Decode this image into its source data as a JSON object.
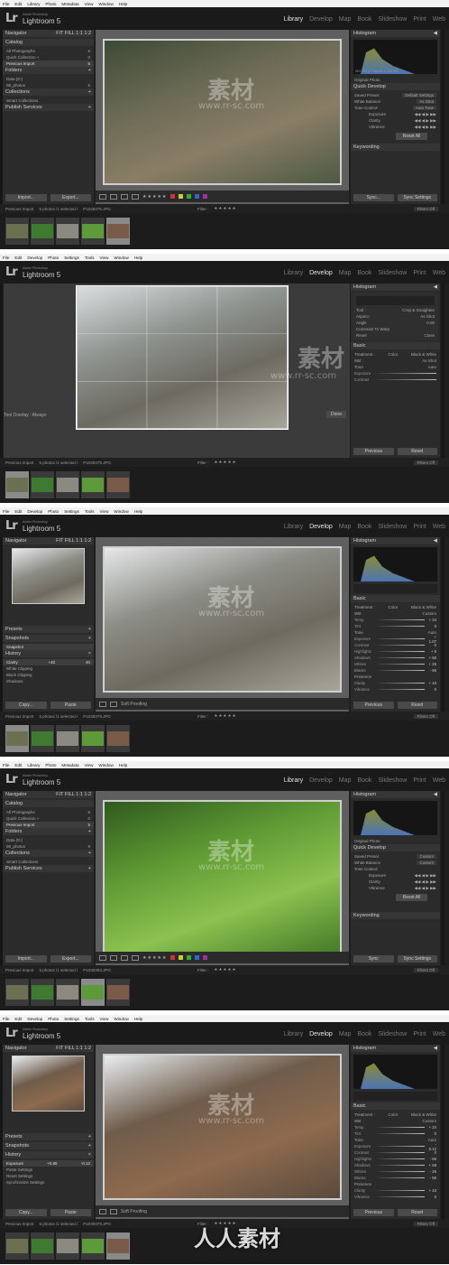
{
  "menus": {
    "library": [
      "File",
      "Edit",
      "Library",
      "Photo",
      "Metadata",
      "View",
      "Window",
      "Help"
    ],
    "develop": [
      "File",
      "Edit",
      "Develop",
      "Photo",
      "Settings",
      "Tools",
      "View",
      "Window",
      "Help"
    ]
  },
  "app": {
    "brand_small": "Adobe Photoshop",
    "brand": "Lightroom 5",
    "logo": "Lr"
  },
  "modules": [
    "Library",
    "Develop",
    "Map",
    "Book",
    "Slideshow",
    "Print",
    "Web"
  ],
  "frames": [
    {
      "active_module": "Library",
      "left": {
        "sections": [
          {
            "title": "Navigator",
            "extra": "FIT  FILL  1:1  1:2 ",
            "rows": []
          },
          {
            "title": "Catalog",
            "extra": "",
            "rows": [
              {
                "l": "All Photographs",
                "r": "5"
              },
              {
                "l": "Quick Collection +",
                "r": "0"
              },
              {
                "l": "Previous Import",
                "r": "5",
                "hl": true
              }
            ]
          },
          {
            "title": "Folders",
            "extra": "+",
            "rows": [
              {
                "l": "Data (D:)",
                "r": ""
              },
              {
                "l": "08_photos",
                "r": "5"
              }
            ]
          },
          {
            "title": "Collections",
            "extra": "+",
            "rows": [
              {
                "l": "Smart Collections",
                "r": ""
              }
            ]
          },
          {
            "title": "Publish Services",
            "extra": "+",
            "rows": []
          }
        ],
        "buttons": [
          "Import...",
          "Export..."
        ]
      },
      "right": {
        "histogram_title": "Histogram",
        "histogram_info": "ISO 125  4.7 mm  f/3.3  1/60 sec",
        "original_photo": "Original Photo",
        "quick_develop": "Quick Develop",
        "rows": [
          {
            "l": "Saved Preset",
            "r": "Default Settings"
          },
          {
            "l": "White Balance",
            "r": "As Shot"
          },
          {
            "l": "Tone Control",
            "r": "Auto Tone"
          }
        ],
        "sub": [
          "Exposure",
          "Clarity",
          "Vibrance"
        ],
        "reset": "Reset All",
        "keywording": "Keywording",
        "buttons": [
          "Sync...",
          "Sync Settings"
        ]
      },
      "strip": {
        "label": "Previous Import",
        "count": "5 photos /1 selected /",
        "file": "P1030476.JPG",
        "filter": "Filter :",
        "filters_off": "Filters Off"
      }
    },
    {
      "active_module": "Develop",
      "tool_overlay": "Tool Overlay : Always",
      "done": "Done",
      "right": {
        "histogram_title": "Histogram",
        "tool": "Tool :",
        "tool_name": "Crop & Straighten",
        "aspect": "Aspect :",
        "aspect_val": "As Shot",
        "angle": "Angle",
        "angle_val": "0.00",
        "constrain": "Constrain To Warp",
        "reset": "Reset",
        "close": "Close",
        "basic": "Basic",
        "treatment": "Treatment :",
        "color": "Color",
        "bw": "Black & White",
        "wb": "WB :",
        "wb_val": "As Shot",
        "tone": "Tone",
        "auto": "Auto",
        "exposure": "Exposure",
        "contrast": "Contrast",
        "buttons": [
          "Previous",
          "Reset"
        ]
      },
      "strip": {
        "label": "Previous Import",
        "count": "5 photos /1 selected /",
        "file": "P1030379.JPG",
        "filter": "Filter :",
        "filters_off": "Filters Off"
      }
    },
    {
      "active_module": "Develop",
      "left": {
        "navigator": "Navigator",
        "nav_extra": "FIT  FILL  1:1  1:2 ",
        "presets": "Presets",
        "snapshots": "Snapshots",
        "snapshot_item": "Snapshot",
        "history": "History",
        "history_rows": [
          {
            "l": "Clarity",
            "m": "+40",
            "r": "40",
            "hl": true
          },
          {
            "l": "White Clipping",
            "m": "",
            "r": ""
          },
          {
            "l": "Black Clipping",
            "m": "",
            "r": ""
          },
          {
            "l": "Shadows",
            "m": "",
            "r": ""
          }
        ],
        "buttons": [
          "Copy...",
          "Paste"
        ]
      },
      "soft_proofing": "Soft Proofing",
      "right": {
        "histogram_title": "Histogram",
        "basic": "Basic",
        "treatment": "Treatment :",
        "color": "Color",
        "bw": "Black & White",
        "wb": "WB :",
        "wb_val": "Custom",
        "sliders": [
          {
            "l": "Temp",
            "v": "+ 34"
          },
          {
            "l": "Tint",
            "v": "0"
          },
          {
            "l": "Exposure",
            "v": "+ 1.07"
          },
          {
            "l": "Contrast",
            "v": "0"
          },
          {
            "l": "Highlights",
            "v": "+ 5"
          },
          {
            "l": "Shadows",
            "v": "+ 60"
          },
          {
            "l": "Whites",
            "v": "+ 26"
          },
          {
            "l": "Blacks",
            "v": "- 56"
          },
          {
            "l": "Clarity",
            "v": "+ 43"
          },
          {
            "l": "Vibrance",
            "v": "0"
          }
        ],
        "tone": "Tone",
        "auto": "Auto",
        "presence": "Presence",
        "buttons": [
          "Previous",
          "Reset"
        ]
      },
      "strip": {
        "label": "Previous Import",
        "count": "5 photos /1 selected /",
        "file": "P1030379.JPG",
        "filter": "Filter :",
        "filters_off": "Filters Off"
      }
    },
    {
      "active_module": "Library",
      "left": {
        "sections": [
          {
            "title": "Navigator",
            "extra": "FIT  FILL  1:1  1:2 ",
            "rows": []
          },
          {
            "title": "Catalog",
            "extra": "",
            "rows": [
              {
                "l": "All Photographs",
                "r": "5"
              },
              {
                "l": "Quick Collection +",
                "r": "0"
              },
              {
                "l": "Previous Import",
                "r": "5",
                "hl": true
              }
            ]
          },
          {
            "title": "Folders",
            "extra": "+",
            "rows": [
              {
                "l": "Data (D:)",
                "r": ""
              },
              {
                "l": "08_photos",
                "r": "5"
              }
            ]
          },
          {
            "title": "Collections",
            "extra": "+",
            "rows": [
              {
                "l": "Smart Collections",
                "r": ""
              }
            ]
          },
          {
            "title": "Publish Services",
            "extra": "+",
            "rows": []
          }
        ],
        "buttons": [
          "Import...",
          "Export..."
        ]
      },
      "right": {
        "histogram_title": "Histogram",
        "original_photo": "Original Photo",
        "quick_develop": "Quick Develop",
        "rows": [
          {
            "l": "Saved Preset",
            "r": "Custom"
          },
          {
            "l": "White Balance",
            "r": "Custom"
          },
          {
            "l": "Tone Control",
            "r": ""
          }
        ],
        "sub": [
          "Exposure",
          "Clarity",
          "Vibrance"
        ],
        "reset": "Reset All",
        "keywording": "Keywording",
        "buttons": [
          "Sync",
          "Sync Settings"
        ]
      },
      "strip": {
        "label": "Previous Import",
        "count": "5 photos /1 selected /",
        "file": "P1030393.JPG",
        "filter": "Filter :",
        "filters_off": "Filters Off"
      }
    },
    {
      "active_module": "Develop",
      "left": {
        "navigator": "Navigator",
        "nav_extra": "FIT  FILL  1:1  1:2 ",
        "presets": "Presets",
        "snapshots": "Snapshots",
        "history": "History",
        "history_rows": [
          {
            "l": "Exposure",
            "m": "+0.85",
            "r": "-0.12",
            "hl": true
          },
          {
            "l": "Paste Settings",
            "m": "",
            "r": ""
          },
          {
            "l": "Reset Settings",
            "m": "",
            "r": ""
          },
          {
            "l": "Synchronize Settings",
            "m": "",
            "r": ""
          }
        ],
        "buttons": [
          "Copy...",
          "Paste"
        ]
      },
      "soft_proofing": "Soft Proofing",
      "right": {
        "histogram_title": "Histogram",
        "basic": "Basic",
        "treatment": "Treatment :",
        "color": "Color",
        "bw": "Black & White",
        "wb": "WB :",
        "wb_val": "Custom",
        "sliders": [
          {
            "l": "Temp",
            "v": "+ 24"
          },
          {
            "l": "Tint",
            "v": "0"
          },
          {
            "l": "Exposure",
            "v": "- 0.12"
          },
          {
            "l": "Contrast",
            "v": "0"
          },
          {
            "l": "Highlights",
            "v": "- 56"
          },
          {
            "l": "Shadows",
            "v": "+ 58"
          },
          {
            "l": "Whites",
            "v": "- 26"
          },
          {
            "l": "Blacks",
            "v": "- 56"
          },
          {
            "l": "Clarity",
            "v": "+ 43"
          },
          {
            "l": "Vibrance",
            "v": "0"
          }
        ],
        "tone": "Tone",
        "auto": "Auto",
        "presence": "Presence",
        "buttons": [
          "Previous",
          "Reset"
        ]
      },
      "strip": {
        "label": "Previous Import",
        "count": "5 photos /1 selected /",
        "file": "P1030379.JPG",
        "filter": "Filter :",
        "filters_off": "Filters Off"
      }
    }
  ],
  "watermark": {
    "cn": "素材",
    "url": "www.rr-sc.com",
    "bottom": "人人素材"
  },
  "colors": {
    "accent": "#cfcfcf",
    "panel": "#2b2b2b",
    "bg": "#1e1e1e"
  },
  "icons": [
    "lr-logo-icon",
    "triangle-icon",
    "star-icon",
    "color-label-icon",
    "grid-view-icon",
    "loupe-view-icon"
  ]
}
